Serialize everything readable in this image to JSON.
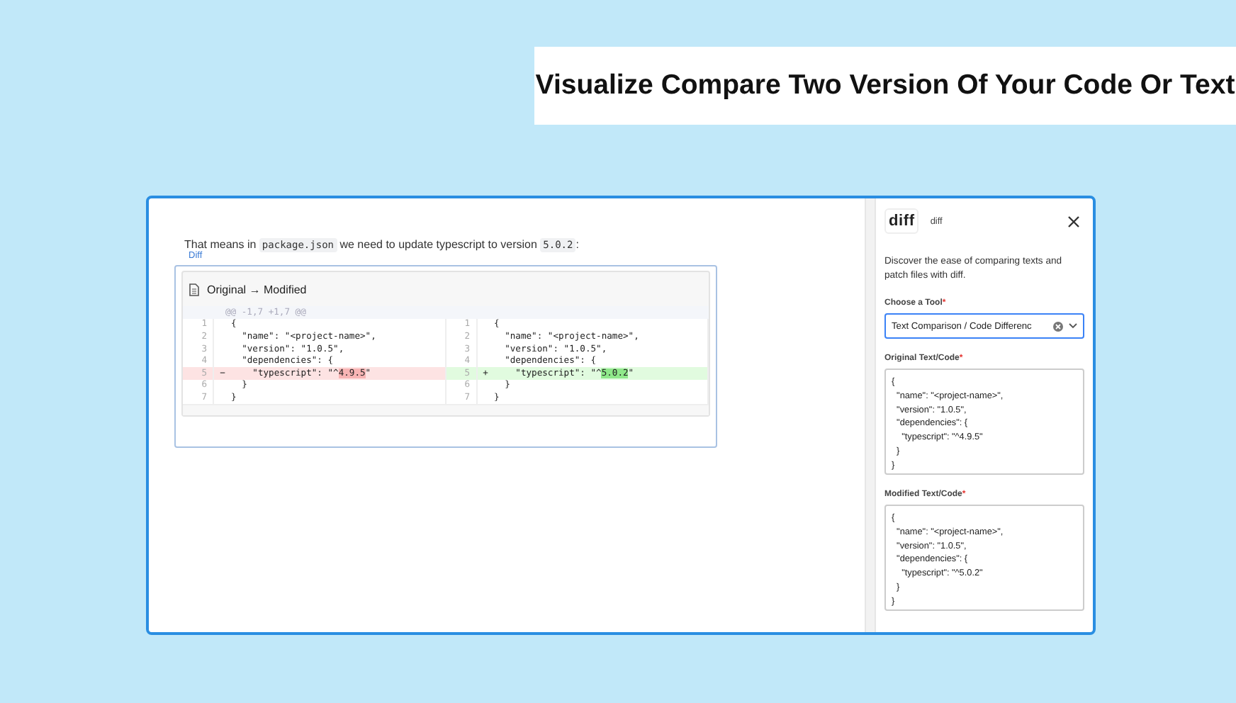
{
  "headline": "Visualize Compare Two Version Of Your Code Or Text",
  "article": {
    "intro_parts": [
      {
        "text": "That means in ",
        "code": false
      },
      {
        "text": "package.json",
        "code": true
      },
      {
        "text": " we need to update typescript to version ",
        "code": false
      },
      {
        "text": "5.0.2",
        "code": true
      },
      {
        "text": ":",
        "code": false
      }
    ],
    "diff_label": "Diff",
    "diff": {
      "title": "Original → Modified",
      "hunk": "@@ -1,7 +1,7 @@",
      "rows": [
        {
          "kind": "context",
          "left": {
            "num": "1",
            "parts": [
              {
                "text": "{",
                "changed": false
              }
            ]
          },
          "right": {
            "num": "1",
            "parts": [
              {
                "text": "{",
                "changed": false
              }
            ]
          }
        },
        {
          "kind": "context",
          "left": {
            "num": "2",
            "parts": [
              {
                "text": "  \"name\": \"<project-name>\",",
                "changed": false
              }
            ]
          },
          "right": {
            "num": "2",
            "parts": [
              {
                "text": "  \"name\": \"<project-name>\",",
                "changed": false
              }
            ]
          }
        },
        {
          "kind": "context",
          "left": {
            "num": "3",
            "parts": [
              {
                "text": "  \"version\": \"1.0.5\",",
                "changed": false
              }
            ]
          },
          "right": {
            "num": "3",
            "parts": [
              {
                "text": "  \"version\": \"1.0.5\",",
                "changed": false
              }
            ]
          }
        },
        {
          "kind": "context",
          "left": {
            "num": "4",
            "parts": [
              {
                "text": "  \"dependencies\": {",
                "changed": false
              }
            ]
          },
          "right": {
            "num": "4",
            "parts": [
              {
                "text": "  \"dependencies\": {",
                "changed": false
              }
            ]
          }
        },
        {
          "kind": "change",
          "left": {
            "num": "5",
            "sign": "−",
            "parts": [
              {
                "text": "    \"typescript\": \"^",
                "changed": false
              },
              {
                "text": "4.9.5",
                "changed": true
              },
              {
                "text": "\"",
                "changed": false
              }
            ]
          },
          "right": {
            "num": "5",
            "sign": "+",
            "parts": [
              {
                "text": "    \"typescript\": \"^",
                "changed": false
              },
              {
                "text": "5.0.2",
                "changed": true
              },
              {
                "text": "\"",
                "changed": false
              }
            ]
          }
        },
        {
          "kind": "context",
          "left": {
            "num": "6",
            "parts": [
              {
                "text": "  }",
                "changed": false
              }
            ]
          },
          "right": {
            "num": "6",
            "parts": [
              {
                "text": "  }",
                "changed": false
              }
            ]
          }
        },
        {
          "kind": "context",
          "left": {
            "num": "7",
            "parts": [
              {
                "text": "}",
                "changed": false
              }
            ]
          },
          "right": {
            "num": "7",
            "parts": [
              {
                "text": "}",
                "changed": false
              }
            ]
          }
        }
      ]
    }
  },
  "panel": {
    "logo": "diff",
    "name": "diff",
    "description": "Discover the ease of comparing texts and patch files with diff.",
    "fields": [
      {
        "kind": "select",
        "label": "Choose a Tool",
        "required_mark": "*",
        "value": "Text Comparison / Code Differenc"
      },
      {
        "kind": "textarea",
        "label": "Original Text/Code",
        "required_mark": "*",
        "value": "{\n  \"name\": \"<project-name>\",\n  \"version\": \"1.0.5\",\n  \"dependencies\": {\n    \"typescript\": \"^4.9.5\"\n  }\n}"
      },
      {
        "kind": "textarea",
        "label": "Modified Text/Code",
        "required_mark": "*",
        "value": "{\n  \"name\": \"<project-name>\",\n  \"version\": \"1.0.5\",\n  \"dependencies\": {\n    \"typescript\": \"^5.0.2\"\n  }\n}"
      }
    ]
  }
}
